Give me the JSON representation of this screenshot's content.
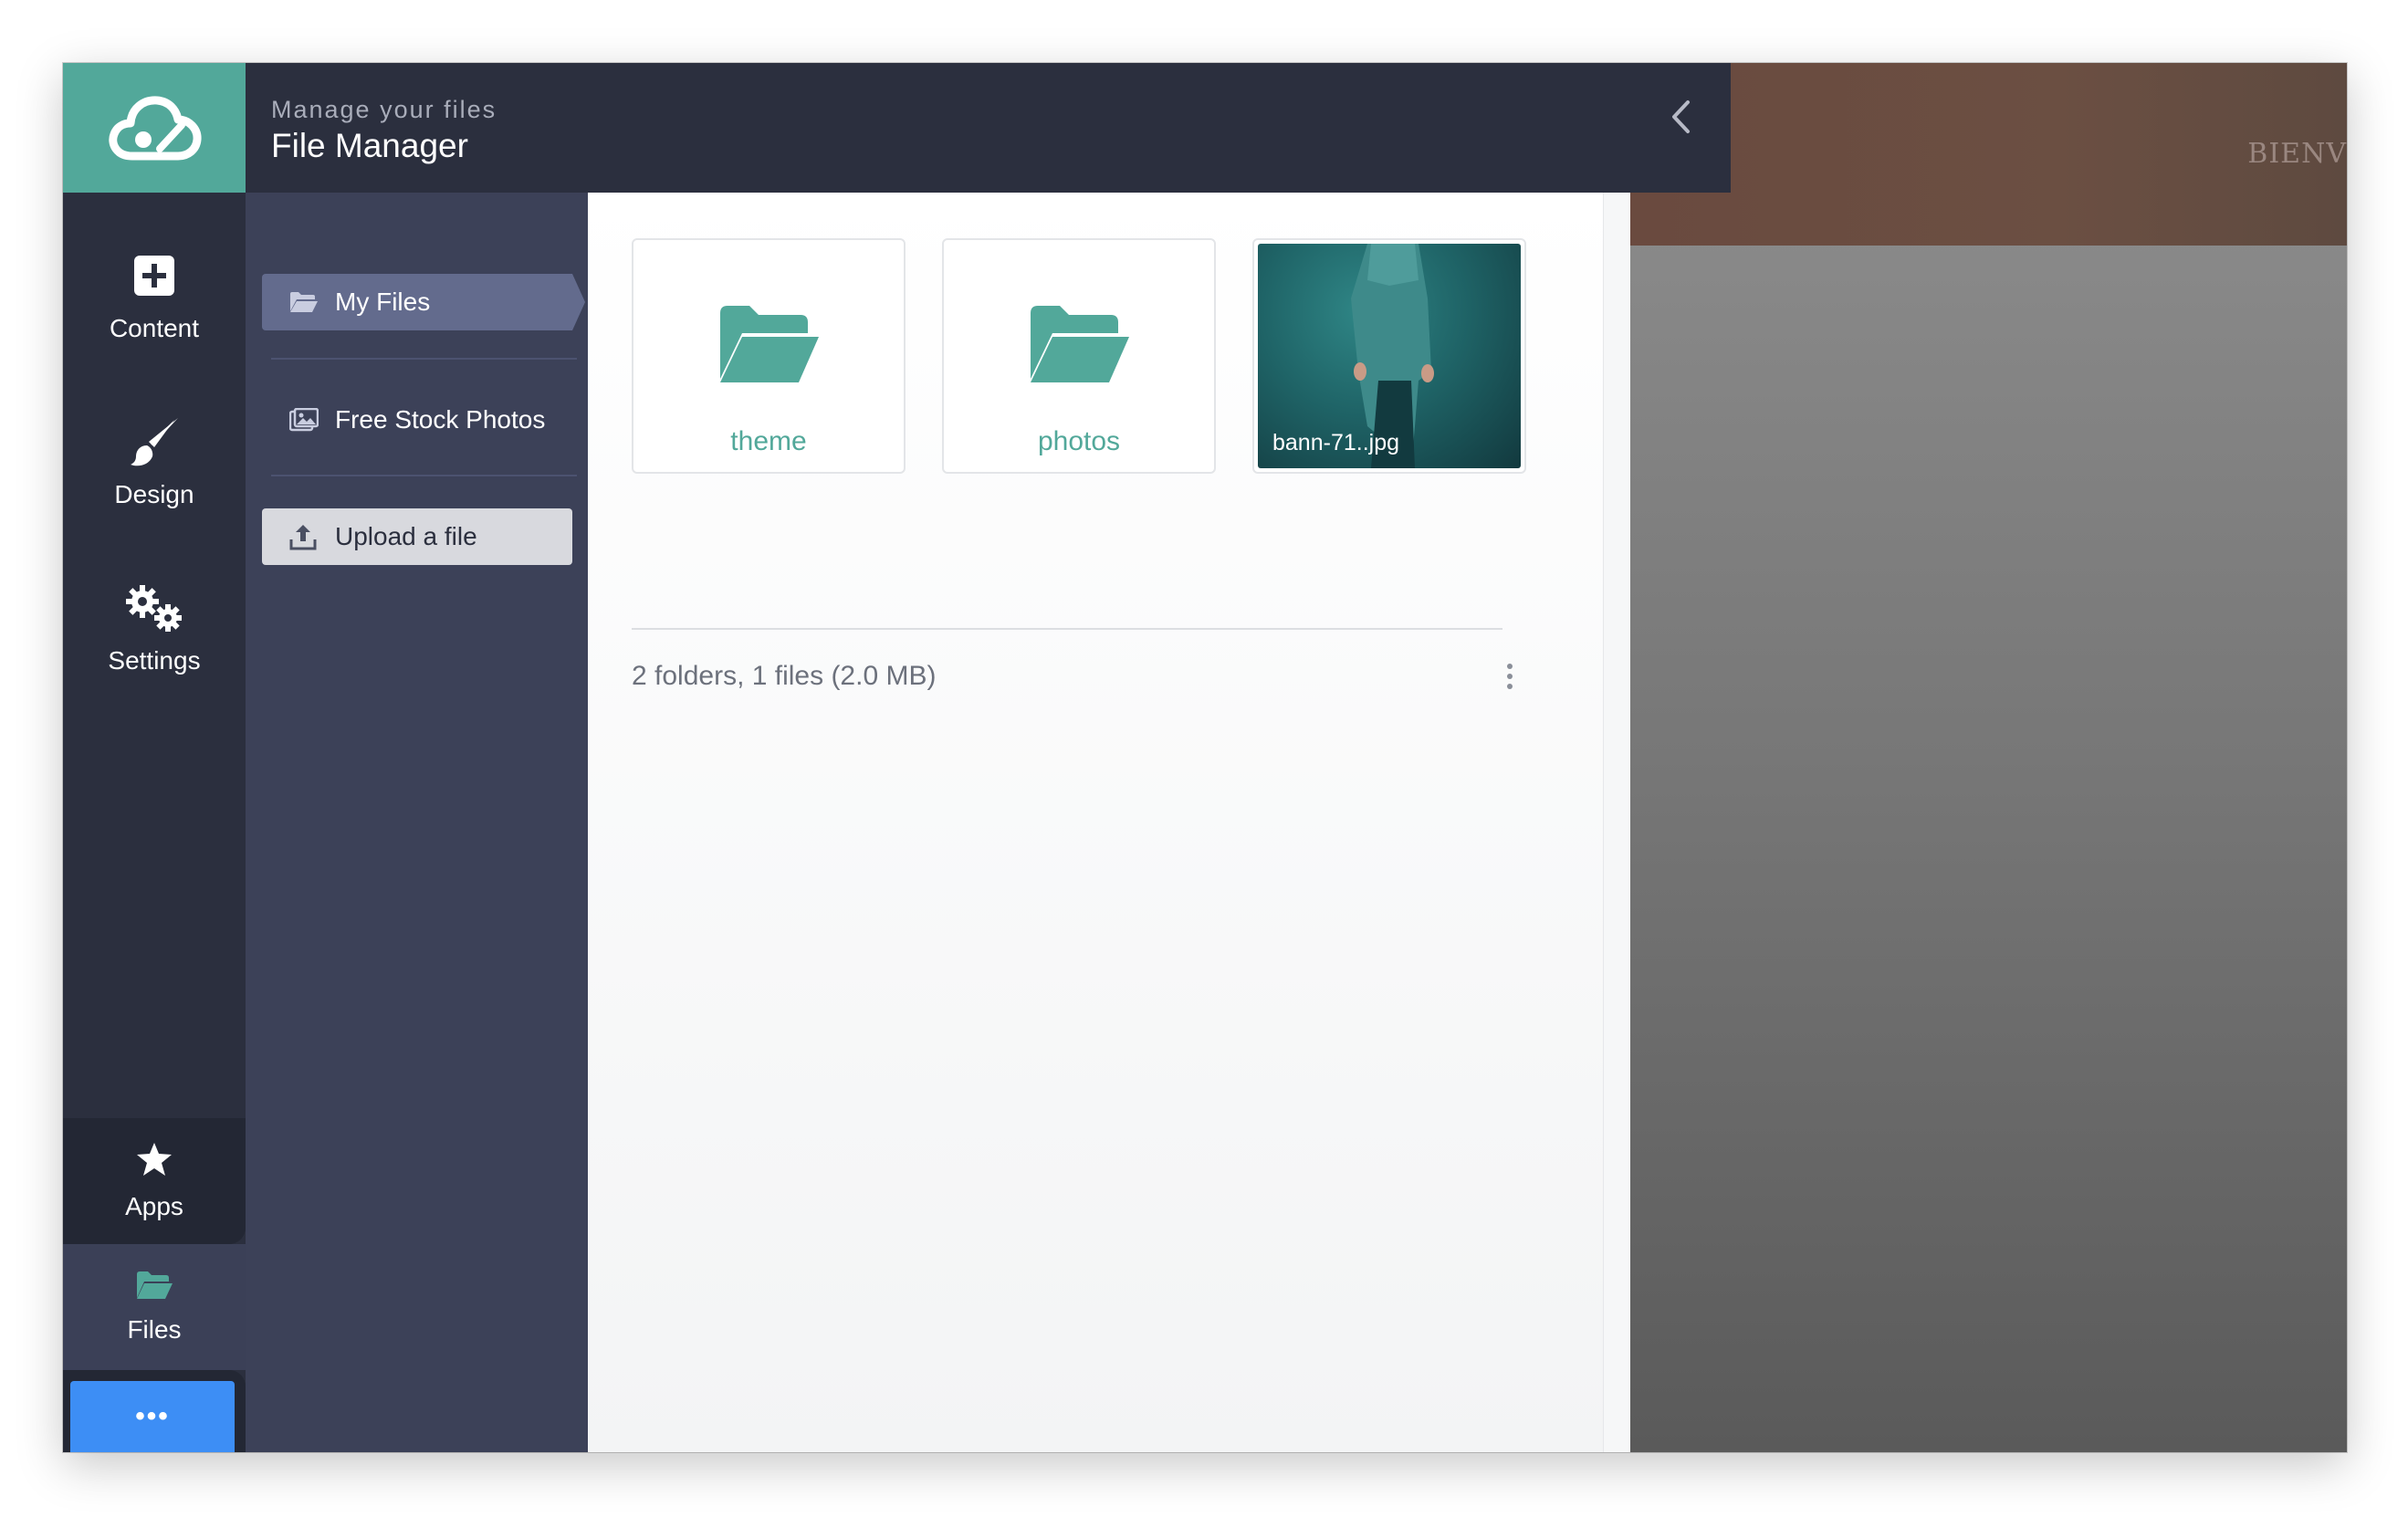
{
  "header": {
    "subtitle": "Manage your files",
    "title": "File Manager"
  },
  "rail": {
    "items": [
      {
        "label": "Content",
        "icon": "plus-square-icon"
      },
      {
        "label": "Design",
        "icon": "paintbrush-icon"
      },
      {
        "label": "Settings",
        "icon": "gears-icon"
      }
    ],
    "apps": {
      "label": "Apps",
      "icon": "star-icon"
    },
    "files": {
      "label": "Files",
      "icon": "folder-open-icon"
    },
    "more": {
      "label": "•••"
    }
  },
  "sidebar": {
    "my_files": "My Files",
    "stock_photos": "Free Stock Photos",
    "upload": "Upload a file"
  },
  "files": {
    "items": [
      {
        "label": "theme",
        "type": "folder"
      },
      {
        "label": "photos",
        "type": "folder"
      },
      {
        "label": "bann-71..jpg",
        "type": "image"
      }
    ],
    "summary": "2 folders, 1 files (2.0 MB)"
  },
  "preview": {
    "band_text": "BIENV"
  },
  "colors": {
    "accent": "#52a89a",
    "rail_bg": "#2b2f3e",
    "sidebar_bg": "#3c4158",
    "active_item": "#636b8d",
    "more_button": "#3d8ef5"
  }
}
